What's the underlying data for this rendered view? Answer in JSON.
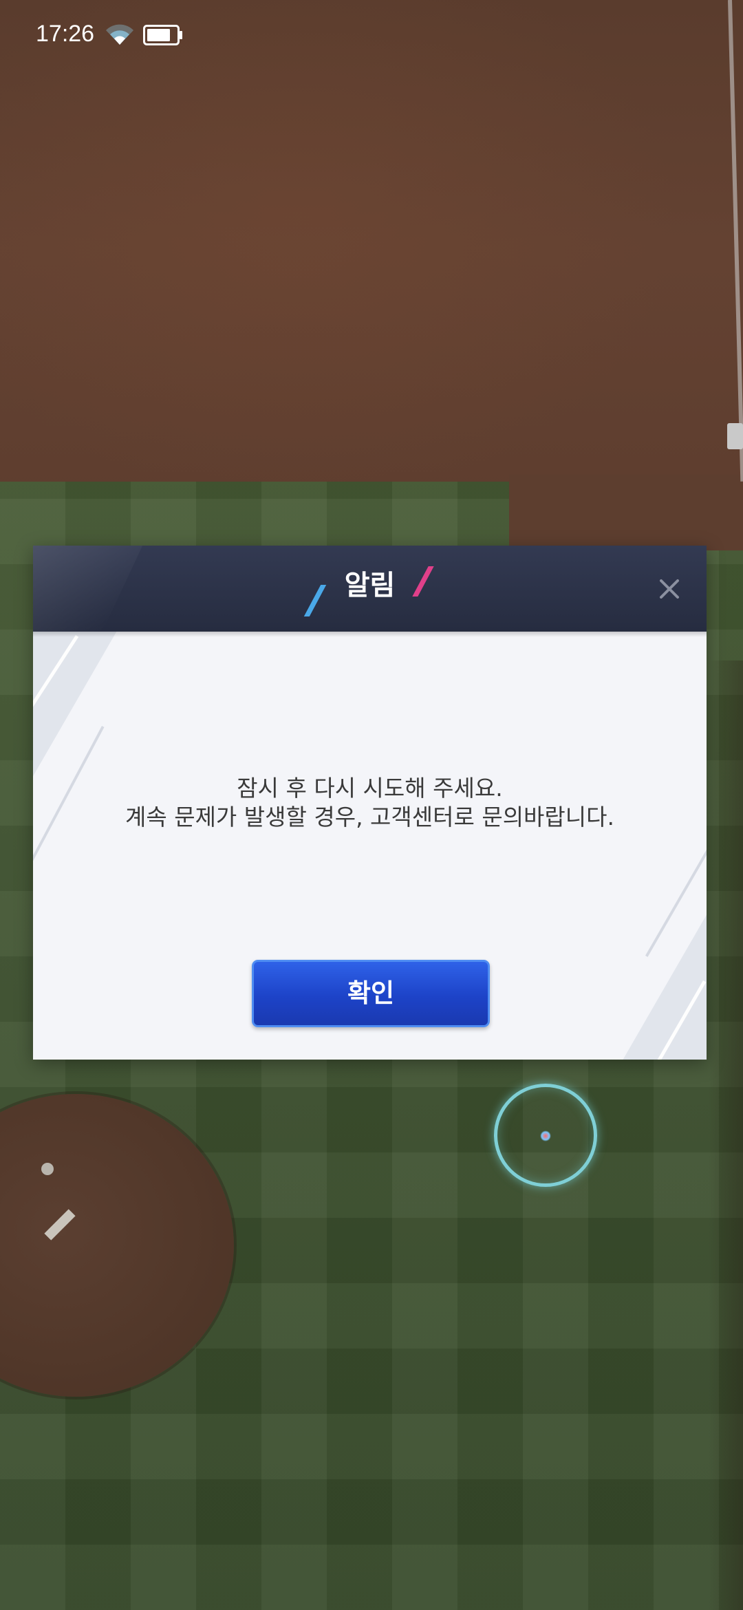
{
  "status_bar": {
    "time": "17:26",
    "wifi_icon": "wifi-icon",
    "battery_icon": "battery-icon"
  },
  "dialog": {
    "title": "알림",
    "close_icon": "close-icon",
    "message_line1": "잠시 후 다시 시도해 주세요.",
    "message_line2": "계속 문제가 발생할 경우, 고객센터로 문의바랍니다.",
    "confirm_label": "확인"
  },
  "colors": {
    "header": "#2a3045",
    "button": "#1f46cc",
    "accent_blue": "#4aa8e8",
    "accent_pink": "#e0408a"
  }
}
